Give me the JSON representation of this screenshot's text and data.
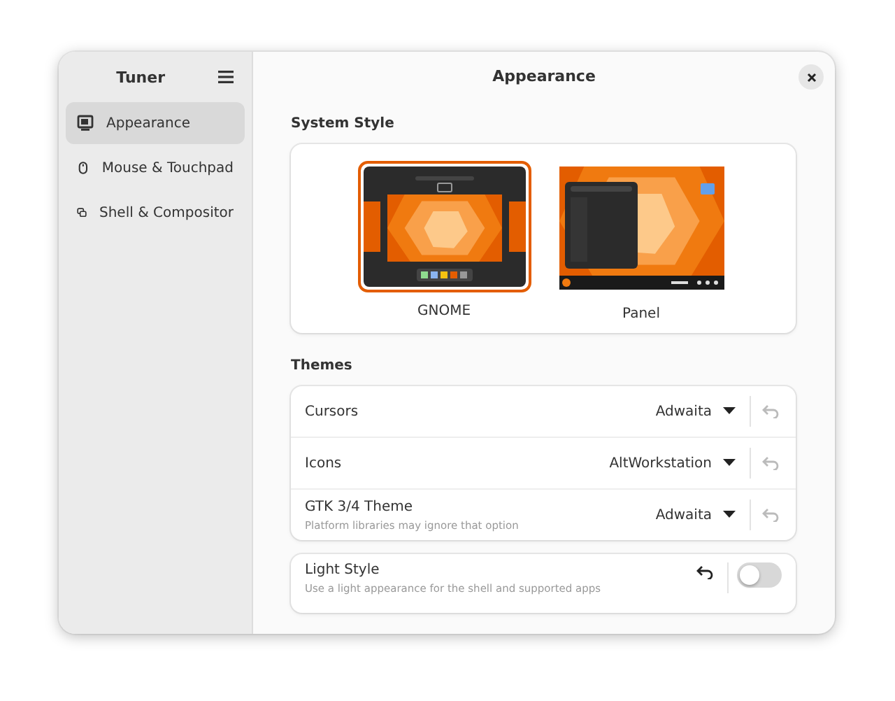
{
  "sidebar": {
    "title": "Tuner",
    "items": [
      {
        "label": "Appearance",
        "kind": "appearance",
        "selected": true
      },
      {
        "label": "Mouse & Touchpad",
        "kind": "mouse",
        "selected": false
      },
      {
        "label": "Shell & Compositor",
        "kind": "shell",
        "selected": false
      }
    ]
  },
  "header": {
    "title": "Appearance"
  },
  "system_style": {
    "heading": "System Style",
    "options": [
      {
        "label": "GNOME",
        "kind": "gnome",
        "selected": true
      },
      {
        "label": "Panel",
        "kind": "panel",
        "selected": false
      }
    ]
  },
  "themes": {
    "heading": "Themes",
    "rows": [
      {
        "label": "Cursors",
        "value": "Adwaita",
        "reset_enabled": false
      },
      {
        "label": "Icons",
        "value": "AltWorkstation",
        "reset_enabled": false
      },
      {
        "label": "GTK 3/4 Theme",
        "subtitle": "Platform libraries may ignore that option",
        "value": "Adwaita",
        "reset_enabled": false
      }
    ]
  },
  "light_style": {
    "label": "Light Style",
    "subtitle": "Use a light appearance for the shell and supported apps",
    "reset_enabled": true,
    "on": false
  }
}
